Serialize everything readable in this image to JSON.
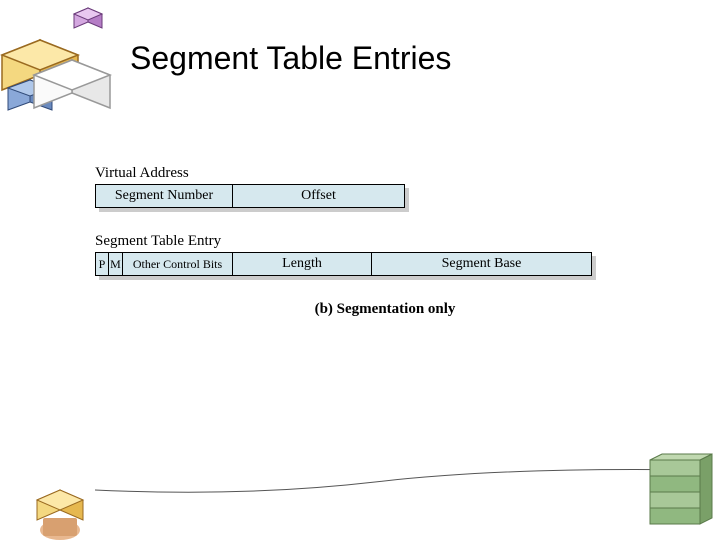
{
  "title": "Segment Table Entries",
  "virtual_address": {
    "label": "Virtual Address",
    "fields": {
      "segment_number": "Segment Number",
      "offset": "Offset"
    }
  },
  "segment_table_entry": {
    "label": "Segment Table Entry",
    "fields": {
      "p": "P",
      "m": "M",
      "other_control_bits": "Other Control Bits",
      "length": "Length",
      "segment_base": "Segment Base"
    }
  },
  "caption": "(b) Segmentation only"
}
